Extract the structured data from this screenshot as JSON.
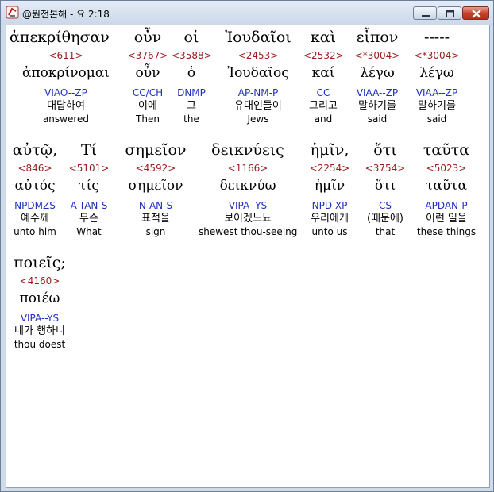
{
  "window": {
    "title": "@원전본해 - 요 2:18"
  },
  "words": [
    {
      "greek": "ἀπεκρίθησαν",
      "strong": "<611>",
      "lemma": "ἀποκρίνομαι",
      "morph": "VIAO--ZP",
      "korean": "대답하여",
      "english": "answered"
    },
    {
      "greek": "οὖν",
      "strong": "<3767>",
      "lemma": "οὖν",
      "morph": "CC/CH",
      "korean": "이에",
      "english": "Then"
    },
    {
      "greek": "οἱ",
      "strong": "<3588>",
      "lemma": "ὁ",
      "morph": "DNMP",
      "korean": "그",
      "english": "the"
    },
    {
      "greek": "Ἰουδαῖοι",
      "strong": "<2453>",
      "lemma": "Ἰουδαῖος",
      "morph": "AP-NM-P",
      "korean": "유대인들이",
      "english": "Jews"
    },
    {
      "greek": "καὶ",
      "strong": "<2532>",
      "lemma": "καί",
      "morph": "CC",
      "korean": "그리고",
      "english": "and"
    },
    {
      "greek": "εἶπον",
      "strong": "<*3004>",
      "lemma": "λέγω",
      "morph": "VIAA--ZP",
      "korean": "말하기를",
      "english": "said"
    },
    {
      "greek": "-----",
      "strong": "<*3004>",
      "lemma": "λέγω",
      "morph": "VIAA--ZP",
      "korean": "말하기를",
      "english": "said"
    },
    {
      "greek": "αὐτῷ,",
      "strong": "<846>",
      "lemma": "αὐτός",
      "morph": "NPDMZS",
      "korean": "예수께",
      "english": "unto him"
    },
    {
      "greek": "Τί",
      "strong": "<5101>",
      "lemma": "τίς",
      "morph": "A-TAN-S",
      "korean": "무슨",
      "english": "What"
    },
    {
      "greek": "σημεῖον",
      "strong": "<4592>",
      "lemma": "σημεῖον",
      "morph": "N-AN-S",
      "korean": "표적을",
      "english": "sign"
    },
    {
      "greek": "δεικνύεις",
      "strong": "<1166>",
      "lemma": "δεικνύω",
      "morph": "VIPA--YS",
      "korean": "보이겠느뇨",
      "english": "shewest thou-seeing"
    },
    {
      "greek": "ἡμῖν,",
      "strong": "<2254>",
      "lemma": "ἡμῖν",
      "morph": "NPD-XP",
      "korean": "우리에게",
      "english": "unto us"
    },
    {
      "greek": "ὅτι",
      "strong": "<3754>",
      "lemma": "ὅτι",
      "morph": "CS",
      "korean": "(때문에)",
      "english": "that"
    },
    {
      "greek": "ταῦτα",
      "strong": "<5023>",
      "lemma": "ταῦτα",
      "morph": "APDAN-P",
      "korean": "이런 일을",
      "english": "these things"
    },
    {
      "greek": "ποιεῖς;",
      "strong": "<4160>",
      "lemma": "ποιέω",
      "morph": "VIPA--YS",
      "korean": "네가 행하니",
      "english": "thou doest"
    }
  ]
}
